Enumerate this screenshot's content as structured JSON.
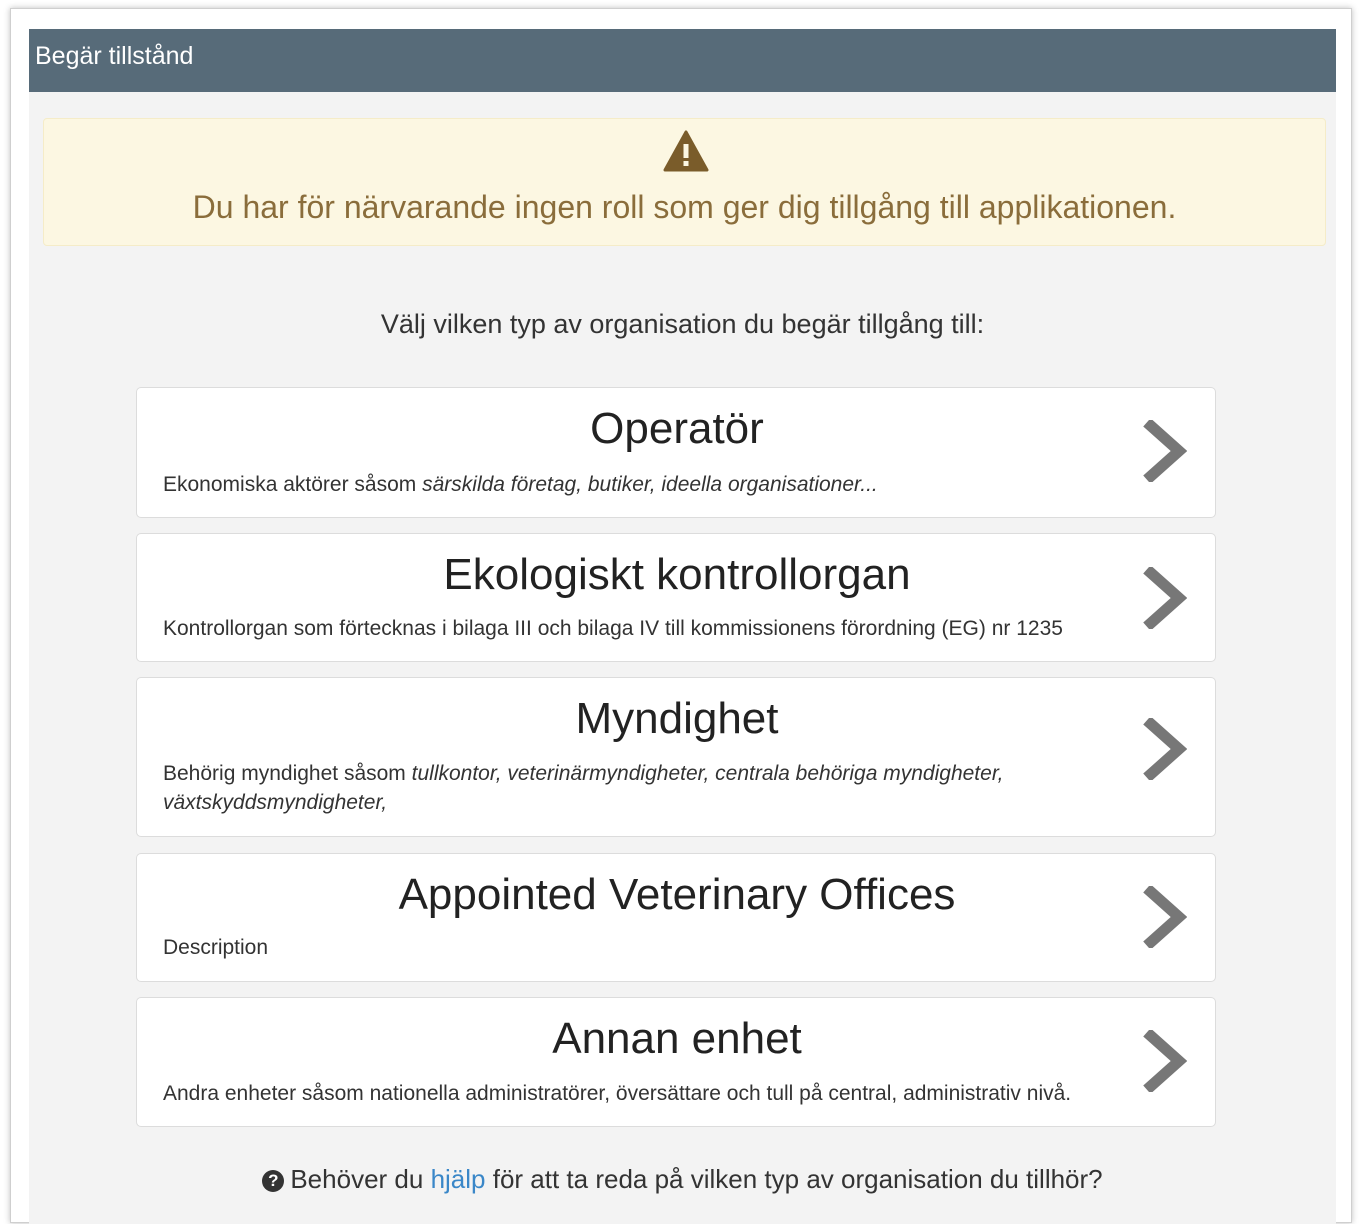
{
  "panel": {
    "title": "Begär tillstånd"
  },
  "alert": {
    "icon": "warning-triangle-icon",
    "text": "Du har för närvarande ingen roll som ger dig tillgång till applikationen."
  },
  "prompt": "Välj vilken typ av organisation du begär tillgång till:",
  "options": [
    {
      "title": "Operatör",
      "desc_plain": "Ekonomiska aktörer såsom ",
      "desc_italic": "särskilda företag, butiker, ideella organisationer..."
    },
    {
      "title": "Ekologiskt kontrollorgan",
      "desc_plain": "Kontrollorgan som förtecknas i bilaga III och bilaga IV till kommissionens förordning (EG) nr 1235",
      "desc_italic": ""
    },
    {
      "title": "Myndighet",
      "desc_plain": "Behörig myndighet såsom ",
      "desc_italic": "tullkontor, veterinärmyndigheter, centrala behöriga myndigheter, växtskyddsmyndigheter,"
    },
    {
      "title": "Appointed Veterinary Offices",
      "desc_plain": "Description",
      "desc_italic": ""
    },
    {
      "title": "Annan enhet",
      "desc_plain": "Andra enheter såsom nationella administratörer, översättare och tull på central, administrativ nivå.",
      "desc_italic": ""
    }
  ],
  "help": {
    "icon": "question-circle-icon",
    "before": "Behöver du ",
    "link": "hjälp",
    "after": " för att ta reda på vilken typ av organisation du tillhör?"
  },
  "colors": {
    "header_bg": "#576b79",
    "alert_bg": "#fcf7e2",
    "alert_text": "#8a6d3b",
    "link": "#3a87c8",
    "chevron": "#777777"
  }
}
